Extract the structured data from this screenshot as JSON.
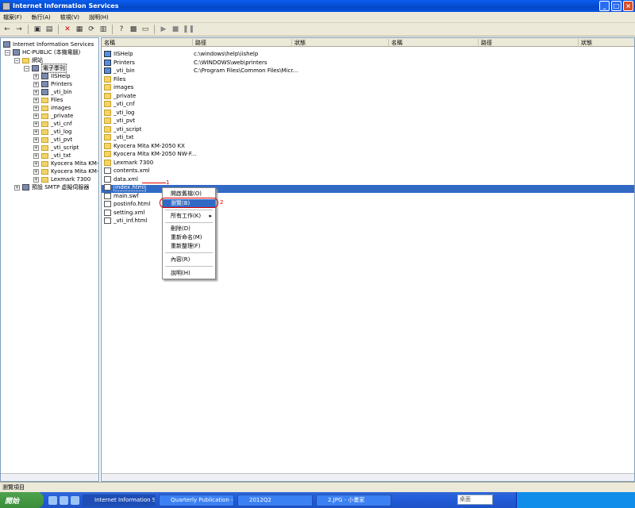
{
  "window": {
    "title": "Internet Information Services"
  },
  "menu": [
    "檔案(F)",
    "執行(A)",
    "檢視(V)",
    "說明(H)"
  ],
  "toolbar": {
    "icons": [
      "back-icon",
      "forward-icon",
      "up-icon",
      "properties-icon",
      "delete-icon",
      "export-icon",
      "refresh-icon",
      "help-icon",
      "play-icon",
      "stop-icon",
      "pause-icon"
    ]
  },
  "tree": {
    "root": "Internet Information Services",
    "server": "HC-PUBLIC (本機電腦)",
    "sites": "網站",
    "site": "電子季刊",
    "children": [
      "IISHelp",
      "Printers",
      "_vti_bin",
      "Files",
      "images",
      "_private",
      "_vti_cnf",
      "_vti_log",
      "_vti_pvt",
      "_vti_script",
      "_vti_txt",
      "Kyocera Mita KM-20",
      "Kyocera Mita KM-20",
      "Lexmark 7300"
    ],
    "smtp": "預設 SMTP 虛擬伺服器"
  },
  "list": {
    "columns": [
      "名稱",
      "路徑",
      "狀態",
      "名稱",
      "路徑",
      "狀態"
    ],
    "items": [
      {
        "name": "IISHelp",
        "path": "c:\\windows\\help\\iishelp",
        "icon": "g"
      },
      {
        "name": "Printers",
        "path": "C:\\WINDOWS\\web\\printers",
        "icon": "g"
      },
      {
        "name": "_vti_bin",
        "path": "C:\\Program Files\\Common Files\\Micr...",
        "icon": "g"
      },
      {
        "name": "Files",
        "path": "",
        "icon": "f"
      },
      {
        "name": "images",
        "path": "",
        "icon": "f"
      },
      {
        "name": "_private",
        "path": "",
        "icon": "f"
      },
      {
        "name": "_vti_cnf",
        "path": "",
        "icon": "f"
      },
      {
        "name": "_vti_log",
        "path": "",
        "icon": "f"
      },
      {
        "name": "_vti_pvt",
        "path": "",
        "icon": "f"
      },
      {
        "name": "_vti_script",
        "path": "",
        "icon": "f"
      },
      {
        "name": "_vti_txt",
        "path": "",
        "icon": "f"
      },
      {
        "name": "Kyocera Mita KM-2050 KX",
        "path": "",
        "icon": "f"
      },
      {
        "name": "Kyocera Mita KM-2050 NW-F...",
        "path": "",
        "icon": "f"
      },
      {
        "name": "Lexmark 7300",
        "path": "",
        "icon": "f"
      },
      {
        "name": "contents.xml",
        "path": "",
        "icon": "d"
      },
      {
        "name": "data.xml",
        "path": "",
        "icon": "d"
      },
      {
        "name": "index.html",
        "path": "",
        "icon": "d"
      },
      {
        "name": "main.swf",
        "path": "",
        "icon": "d"
      },
      {
        "name": "postinfo.html",
        "path": "",
        "icon": "d"
      },
      {
        "name": "setting.xml",
        "path": "",
        "icon": "d"
      },
      {
        "name": "_vti_inf.html",
        "path": "",
        "icon": "d"
      }
    ]
  },
  "context_menu": {
    "items": [
      "開啟舊檔(O)",
      "瀏覽(B)",
      "所有工作(K)",
      "刪除(D)",
      "重新命名(M)",
      "重新整理(F)",
      "內容(R)",
      "說明(H)"
    ],
    "annotation1": "1",
    "annotation2": "2"
  },
  "status": {
    "text": "瀏覽項目"
  },
  "taskbar": {
    "start": "開始",
    "tasks": [
      "Internet Information S...",
      "Quarterly Publication -...",
      "2012Q2",
      "2.JPG - 小畫家"
    ],
    "desktop": "桌面"
  }
}
